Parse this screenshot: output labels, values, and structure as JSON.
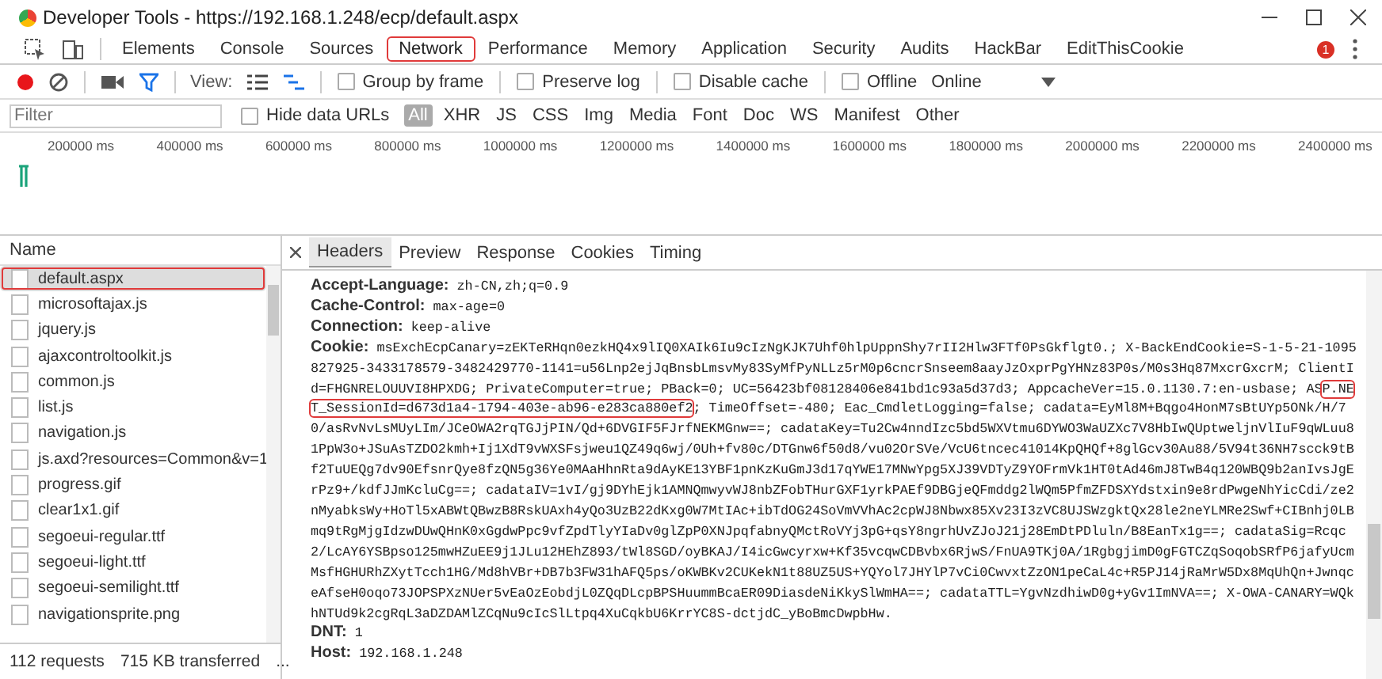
{
  "window": {
    "title": "Developer Tools - https://192.168.1.248/ecp/default.aspx"
  },
  "panel_tabs": [
    {
      "label": "Elements",
      "selected": false,
      "annotated": false
    },
    {
      "label": "Console",
      "selected": false,
      "annotated": false
    },
    {
      "label": "Sources",
      "selected": false,
      "annotated": false
    },
    {
      "label": "Network",
      "selected": true,
      "annotated": true
    },
    {
      "label": "Performance",
      "selected": false,
      "annotated": false
    },
    {
      "label": "Memory",
      "selected": false,
      "annotated": false
    },
    {
      "label": "Application",
      "selected": false,
      "annotated": false
    },
    {
      "label": "Security",
      "selected": false,
      "annotated": false
    },
    {
      "label": "Audits",
      "selected": false,
      "annotated": false
    },
    {
      "label": "HackBar",
      "selected": false,
      "annotated": false
    },
    {
      "label": "EditThisCookie",
      "selected": false,
      "annotated": false
    }
  ],
  "error_count": "1",
  "toolbar": {
    "recording": true,
    "view_label": "View:",
    "options": [
      {
        "label": "Group by frame",
        "checked": false
      },
      {
        "label": "Preserve log",
        "checked": false
      },
      {
        "label": "Disable cache",
        "checked": false
      },
      {
        "label": "Offline",
        "checked": false
      }
    ],
    "throttle": "Online"
  },
  "filter": {
    "placeholder": "Filter",
    "hide_data_urls": {
      "label": "Hide data URLs",
      "checked": false
    },
    "types": [
      {
        "label": "All",
        "selected": true
      },
      {
        "label": "XHR",
        "selected": false
      },
      {
        "label": "JS",
        "selected": false
      },
      {
        "label": "CSS",
        "selected": false
      },
      {
        "label": "Img",
        "selected": false
      },
      {
        "label": "Media",
        "selected": false
      },
      {
        "label": "Font",
        "selected": false
      },
      {
        "label": "Doc",
        "selected": false
      },
      {
        "label": "WS",
        "selected": false
      },
      {
        "label": "Manifest",
        "selected": false
      },
      {
        "label": "Other",
        "selected": false
      }
    ]
  },
  "timeline": {
    "ticks": [
      "200000 ms",
      "400000 ms",
      "600000 ms",
      "800000 ms",
      "1000000 ms",
      "1200000 ms",
      "1400000 ms",
      "1600000 ms",
      "1800000 ms",
      "2000000 ms",
      "2200000 ms",
      "2400000 ms"
    ]
  },
  "requests": {
    "column": "Name",
    "rows": [
      {
        "name": "default.aspx",
        "selected": true,
        "annotated": true
      },
      {
        "name": "microsoftajax.js",
        "selected": false,
        "annotated": false
      },
      {
        "name": "jquery.js",
        "selected": false,
        "annotated": false
      },
      {
        "name": "ajaxcontroltoolkit.js",
        "selected": false,
        "annotated": false
      },
      {
        "name": "common.js",
        "selected": false,
        "annotated": false
      },
      {
        "name": "list.js",
        "selected": false,
        "annotated": false
      },
      {
        "name": "navigation.js",
        "selected": false,
        "annotated": false
      },
      {
        "name": "js.axd?resources=Common&v=1",
        "selected": false,
        "annotated": false
      },
      {
        "name": "progress.gif",
        "selected": false,
        "annotated": false
      },
      {
        "name": "clear1x1.gif",
        "selected": false,
        "annotated": false
      },
      {
        "name": "segoeui-regular.ttf",
        "selected": false,
        "annotated": false
      },
      {
        "name": "segoeui-light.ttf",
        "selected": false,
        "annotated": false
      },
      {
        "name": "segoeui-semilight.ttf",
        "selected": false,
        "annotated": false
      },
      {
        "name": "navigationsprite.png",
        "selected": false,
        "annotated": false
      }
    ],
    "summary": [
      "112 requests",
      "715 KB transferred",
      "..."
    ]
  },
  "detail_tabs": [
    {
      "label": "Headers",
      "selected": true
    },
    {
      "label": "Preview",
      "selected": false
    },
    {
      "label": "Response",
      "selected": false
    },
    {
      "label": "Cookies",
      "selected": false
    },
    {
      "label": "Timing",
      "selected": false
    }
  ],
  "headers": [
    {
      "name": "Accept-Language:",
      "value": [
        {
          "text": "zh-CN,zh;q=0.9",
          "annotated": false
        }
      ]
    },
    {
      "name": "Cache-Control:",
      "value": [
        {
          "text": "max-age=0",
          "annotated": false
        }
      ]
    },
    {
      "name": "Connection:",
      "value": [
        {
          "text": "keep-alive",
          "annotated": false
        }
      ]
    },
    {
      "name": "Cookie:",
      "value": [
        {
          "text": "msExchEcpCanary=zEKTeRHqn0ezkHQ4x9lIQ0XAIk6Iu9cIzNgKJK7Uhf0hlpUppnShy7rII2Hlw3FTf0PsGkflgt0.; X-BackEndCookie=S-1-5-21-1095827925-3433178579-3482429770-1141=u56Lnp2ejJqBnsbLmsvMy83SyMfPyNLLz5rM0p6cncrSnseem8aayJzOxprPgYHNz83P0s/M0s3Hq87MxcrGxcrM; ClientId=FHGNRELOUUVI8HPXDG; PrivateComputer=true; PBack=0; UC=56423bf08128406e841bd1c93a5d37d3; AppcacheVer=15.0.1130.7:en-usbase; AS",
          "annotated": false
        },
        {
          "text": "P.NET_SessionId=d673d1a4-1794-403e-ab96-e283ca880ef2",
          "annotated": true
        },
        {
          "text": "; TimeOffset=-480; Eac_CmdletLogging=false; cadata=EyMl8M+Bqgo4HonM7sBtUYp5ONk/H/70/asRvNvLsMUyLIm/JCeOWA2rqTGJjPIN/Qd+6DVGIF5FJrfNEKMGnw==; cadataKey=Tu2Cw4nndIzc5bd5WXVtmu6DYWO3WaUZXc7V8HbIwQUptweljnVlIuF9qWLuu81PpW3o+JSuAsTZDO2kmh+Ij1XdT9vWXSFsjweu1QZ49q6wj/0Uh+fv80c/DTGnw6f50d8/vu02OrSVe/VcU6tncec41014KpQHQf+8glGcv30Au88/5V94t36NH7scck9tBf2TuUEQg7dv90EfsnrQye8fzQN5g36Ye0MAaHhnRta9dAyKE13YBF1pnKzKuGmJ3d17qYWE17MNwYpg5XJ39VDTyZ9YOFrmVk1HT0tAd46mJ8TwB4q120WBQ9b2anIvsJgErPz9+/kdfJJmKcluCg==; cadataIV=1vI/gj9DYhEjk1AMNQmwyvWJ8nbZFobTHurGXF1yrkPAEf9DBGjeQFmddg2lWQm5PfmZFDSXYdstxin9e8rdPwgeNhYicCdi/ze2nMyabksWy+HoTl5xABWtQBwzB8RskUAxh4yQo3UzB22dKxg0W7MtIAc+ibTdOG24SoVmVVhAc2cpWJ8Nbwx85Xv23I3zVC8UJSWzgktQx28le2neYLMRe2Swf+CIBnhj0LBmq9tRgMjgIdzwDUwQHnK0xGgdwPpc9vfZpdTlyYIaDv0glZpP0XNJpqfabnyQMctRoVYj3pG+qsY8ngrhUvZJoJ21j28EmDtPDluln/B8EanTx1g==; cadataSig=Rcqc2/LcAY6YSBpso125mwHZuEE9j1JLu12HEhZ893/tWl8SGD/oyBKAJ/I4icGwcyrxw+Kf35vcqwCDBvbx6RjwS/FnUA9TKj0A/1RgbgjimD0gFGTCZqSoqobSRfP6jafyUcmMsfHGHURhZXytTcch1HG/Md8hVBr+DB7b3FW31hAFQ5ps/oKWBKv2CUKekN1t88UZ5US+YQYol7JHYlP7vCi0CwvxtZzON1peCaL4c+R5PJ14jRaMrW5Dx8MqUhQn+JwnqceAfseH0oqo73JOPSPXzNUer5vEaOzEobdjL0ZQqDLcpBPSHuummBcaER09DiasdeNiKkySlWmHA==; cadataTTL=YgvNzdhiwD0g+yGv1ImNVA==; X-OWA-CANARY=WQkhNTUd9k2cgRqL3aDZDAMlZCqNu9cIcSlLtpq4XuCqkbU6KrrYC8S-dctjdC_yBoBmcDwpbHw.",
          "annotated": false
        }
      ]
    },
    {
      "name": "DNT:",
      "value": [
        {
          "text": "1",
          "annotated": false
        }
      ]
    },
    {
      "name": "Host:",
      "value": [
        {
          "text": "192.168.1.248",
          "annotated": false
        }
      ]
    }
  ]
}
